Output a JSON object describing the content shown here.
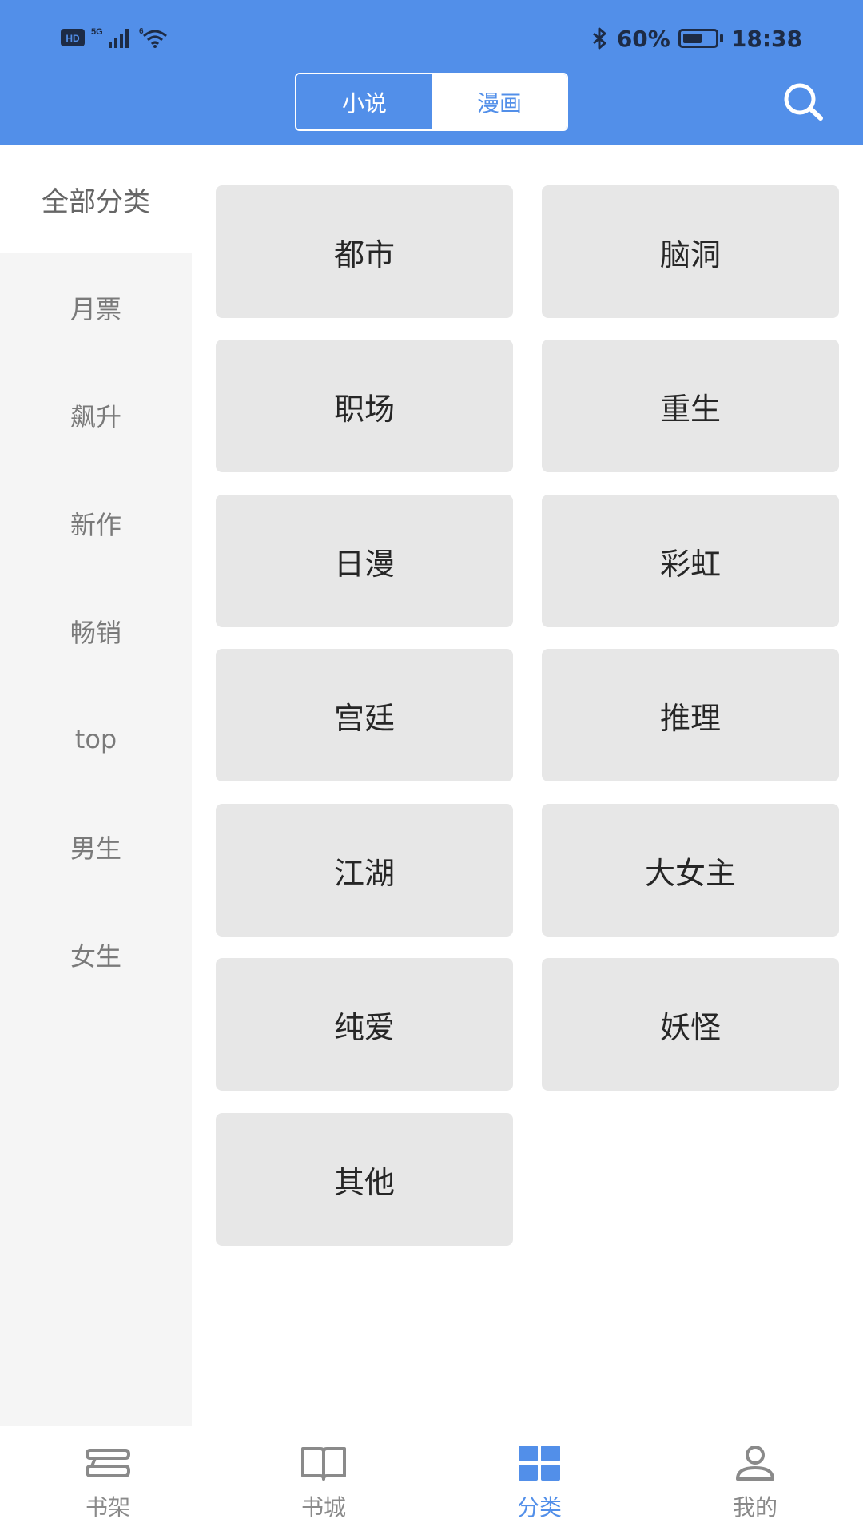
{
  "status_bar": {
    "hd": "HD",
    "network": "5G",
    "wifi_badge": "6",
    "battery": "60%",
    "battery_level": 0.6,
    "time": "18:38",
    "icons": [
      "hd-icon",
      "signal-icon",
      "wifi-icon",
      "bluetooth-icon",
      "battery-icon"
    ]
  },
  "header": {
    "tabs": [
      {
        "label": "小说",
        "active": true
      },
      {
        "label": "漫画",
        "active": false
      }
    ],
    "search_icon": "search-icon"
  },
  "sidebar": {
    "items": [
      {
        "label": "全部分类",
        "active": true
      },
      {
        "label": "月票",
        "active": false
      },
      {
        "label": "飙升",
        "active": false
      },
      {
        "label": "新作",
        "active": false
      },
      {
        "label": "畅销",
        "active": false
      },
      {
        "label": "top",
        "active": false
      },
      {
        "label": "男生",
        "active": false
      },
      {
        "label": "女生",
        "active": false
      }
    ]
  },
  "categories": [
    {
      "label": "都市"
    },
    {
      "label": "脑洞"
    },
    {
      "label": "职场"
    },
    {
      "label": "重生"
    },
    {
      "label": "日漫"
    },
    {
      "label": "彩虹"
    },
    {
      "label": "宫廷"
    },
    {
      "label": "推理"
    },
    {
      "label": "江湖"
    },
    {
      "label": "大女主"
    },
    {
      "label": "纯爱"
    },
    {
      "label": "妖怪"
    },
    {
      "label": "其他"
    }
  ],
  "bottom_nav": {
    "items": [
      {
        "label": "书架",
        "icon": "bookshelf-icon",
        "active": false
      },
      {
        "label": "书城",
        "icon": "book-open-icon",
        "active": false
      },
      {
        "label": "分类",
        "icon": "category-grid-icon",
        "active": true
      },
      {
        "label": "我的",
        "icon": "user-icon",
        "active": false
      }
    ]
  },
  "colors": {
    "brand": "#528fe9",
    "tile_bg": "#e7e7e7",
    "sidebar_bg": "#f5f5f5",
    "nav_inactive": "#8a8a8a"
  }
}
